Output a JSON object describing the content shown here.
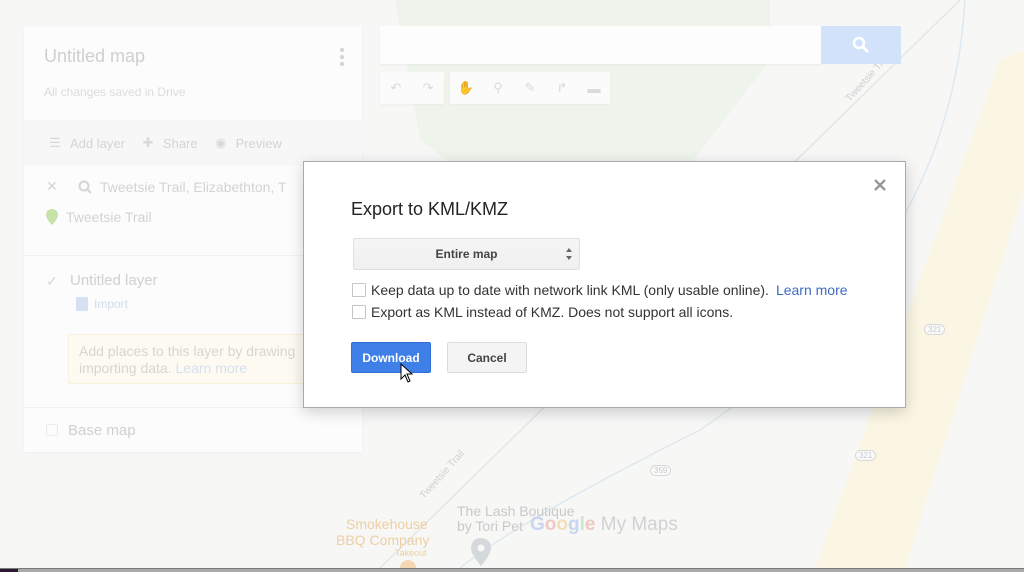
{
  "map": {
    "labels": {
      "trail_top": "Tweetsie Trail",
      "trail_bottom": "Tweetsie Trail",
      "business_1_line1": "Smokehouse",
      "business_1_line2": "BBQ Company",
      "business_1_sub": "Takeout",
      "business_2_line1": "The Lash Boutique",
      "business_2_line2": "by Tori Pet"
    },
    "shields": [
      "321",
      "359",
      "321"
    ],
    "brand": {
      "g": [
        "G",
        "o",
        "o",
        "g",
        "l",
        "e"
      ],
      "suffix": "My Maps"
    }
  },
  "search": {
    "value": "",
    "placeholder": ""
  },
  "toolbar": {
    "tools": [
      "undo",
      "redo",
      "select",
      "marker",
      "line",
      "directions",
      "measure"
    ]
  },
  "panel": {
    "title": "Untitled map",
    "saved_status": "All changes saved in Drive",
    "actions": [
      {
        "label": "Add layer",
        "icon": "layers-icon"
      },
      {
        "label": "Share",
        "icon": "add-person-icon"
      },
      {
        "label": "Preview",
        "icon": "eye-icon"
      }
    ],
    "search_result": {
      "query": "Tweetsie Trail, Elizabethton, T",
      "place": "Tweetsie Trail"
    },
    "layer": {
      "name": "Untitled layer",
      "import_label": "Import",
      "hint_text": "Add places to this layer by drawing or importing data.",
      "hint_visible_line1": "Add places to this layer by drawing",
      "hint_visible_line2": "importing data.",
      "hint_link": "Learn more"
    },
    "base_map_label": "Base map"
  },
  "dialog": {
    "title": "Export to KML/KMZ",
    "select_value": "Entire map",
    "options": [
      {
        "label": "Keep data up to date with network link KML (only usable online).",
        "link": "Learn more",
        "checked": false
      },
      {
        "label": "Export as KML instead of KMZ. Does not support all icons.",
        "checked": false
      }
    ],
    "download_label": "Download",
    "cancel_label": "Cancel",
    "accent_color": "#3e7fe8"
  }
}
